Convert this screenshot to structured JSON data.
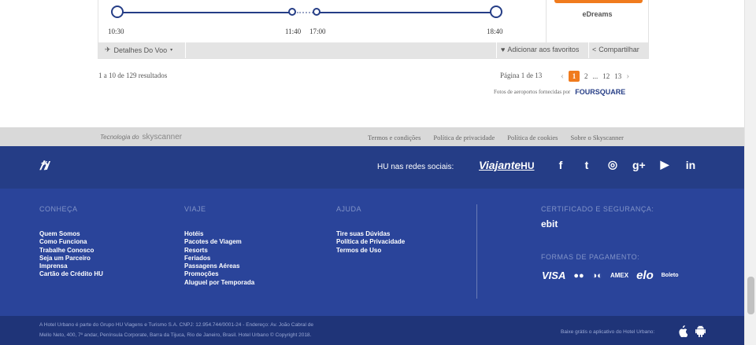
{
  "flight": {
    "times": [
      "10:30",
      "11:40",
      "17:00",
      "18:40"
    ],
    "vendor": "eDreams",
    "details_label": "Detalhes Do Voo",
    "favorite_label": "Adicionar aos favoritos",
    "share_label": "Compartilhar"
  },
  "results": {
    "summary": "1 a 10 de 129 resultados",
    "page_label": "Página 1 de 13",
    "pages": [
      "1",
      "2",
      "...",
      "12",
      "13"
    ],
    "photos_credit": "Fotos de aeroportos fornecidas por",
    "photos_brand": "FOURSQUARE"
  },
  "skyscanner": {
    "tech_label": "Tecnologia do",
    "brand": "skyscanner",
    "links": [
      "Termos e condições",
      "Política de privacidade",
      "Política de cookies",
      "Sobre o Skyscanner"
    ]
  },
  "footer": {
    "logo": "ℏ/",
    "social_label": "HU nas redes sociais:",
    "viajante": "Viajante",
    "viajante_hu": "HU",
    "social_icons": [
      "f",
      "t",
      "◎",
      "g+",
      "▶",
      "in"
    ],
    "conheca": {
      "title": "CONHEÇA",
      "items": [
        "Quem Somos",
        "Como Funciona",
        "Trabalhe Conosco",
        "Seja um Parceiro",
        "Imprensa",
        "Cartão de Crédito HU"
      ]
    },
    "viaje": {
      "title": "VIAJE",
      "items": [
        "Hotéis",
        "Pacotes de Viagem",
        "Resorts",
        "Feriados",
        "Passagens Aéreas",
        "Promoções",
        "Aluguel por Temporada"
      ]
    },
    "ajuda": {
      "title": "AJUDA",
      "items": [
        "Tire suas Dúvidas",
        "Política de Privacidade",
        "Termos de Uso"
      ]
    },
    "cert_title": "CERTIFICADO E SEGURANÇA:",
    "ebit": "ebit",
    "pay_title": "FORMAS DE PAGAMENTO:",
    "pay_methods": [
      "VISA",
      "●●",
      "◑◐",
      "AMEX",
      "elo",
      "Boleto"
    ],
    "legal_line1": "A Hotel Urbano é parte do Grupo HU Viagens e Turismo S.A. CNPJ: 12.954.744/0001-24 - Endereço: Av. João Cabral de",
    "legal_line2": "Mello Neto, 400, 7º andar, Península Corporate, Barra da Tijuca, Rio de Janeiro, Brasil. Hotel Urbano © Copyright 2018.",
    "app_label": "Baixe grátis o aplicativo do Hotel Urbano:"
  }
}
